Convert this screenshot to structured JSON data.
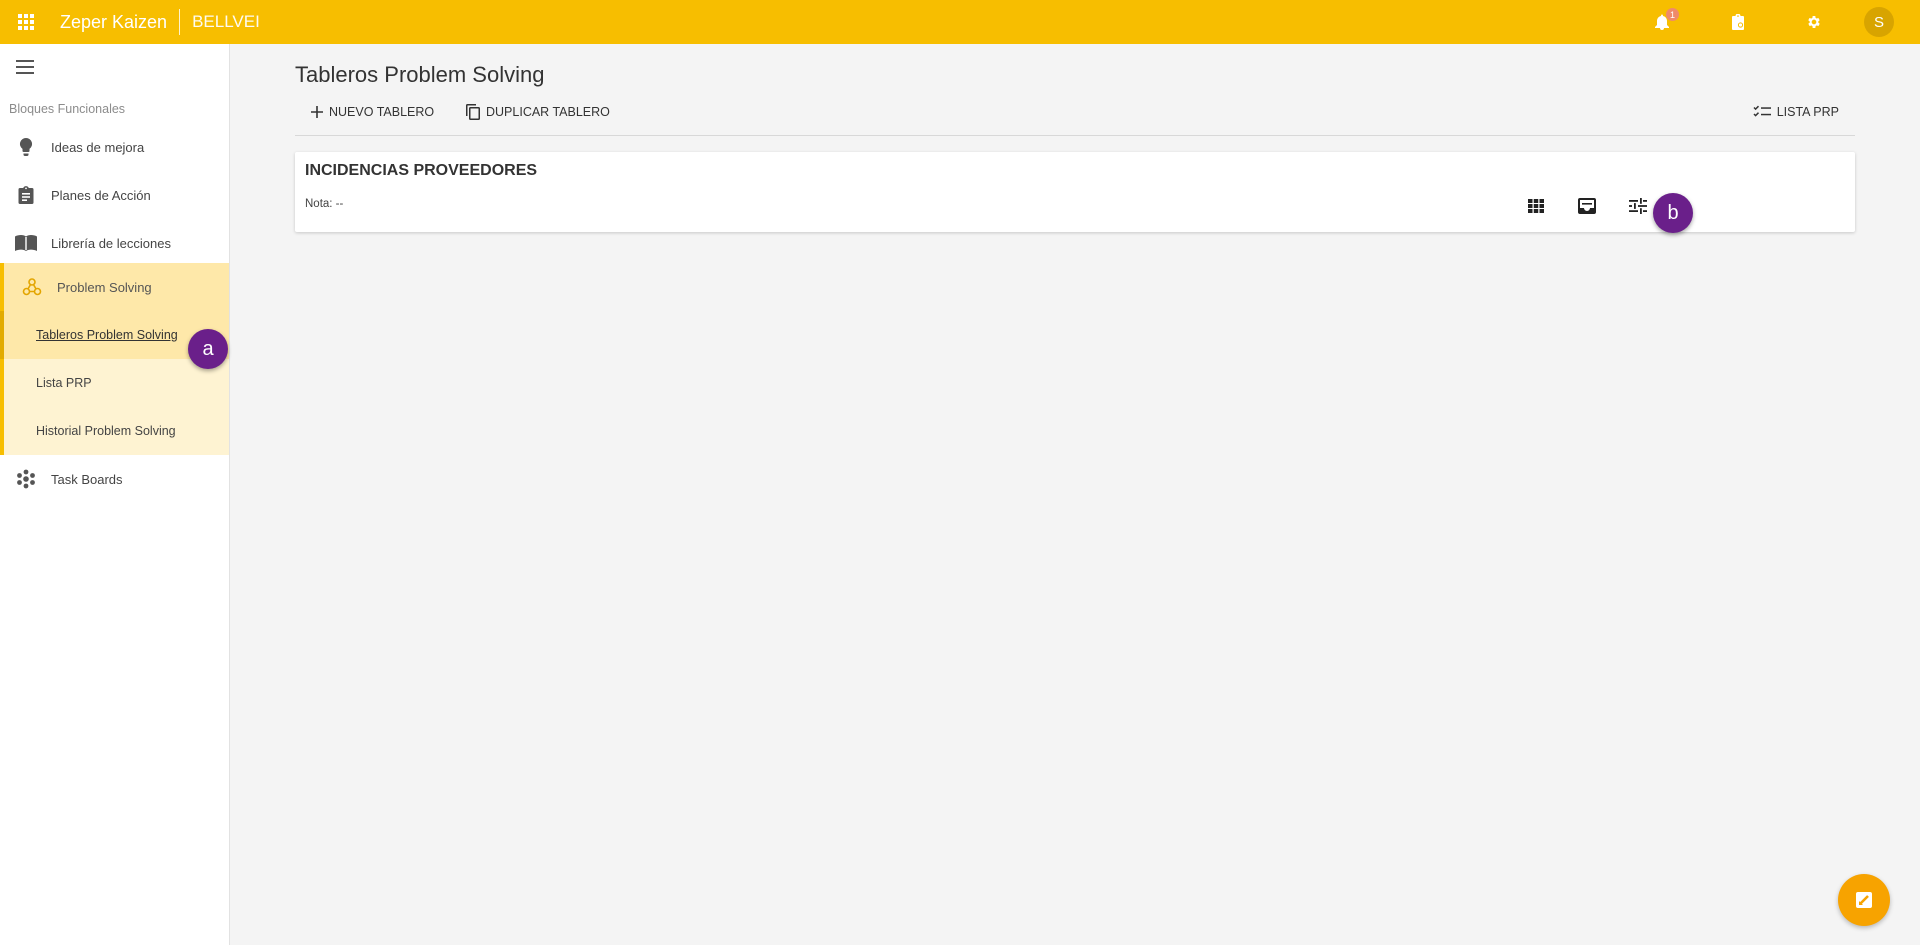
{
  "header": {
    "app_title": "Zeper Kaizen",
    "org_name": "BELLVEI",
    "notification_count": "1",
    "avatar_initial": "S",
    "icons": [
      "apps-icon",
      "bell-icon",
      "clipboard-icon",
      "gear-icon"
    ],
    "bar_color": "#f7be00"
  },
  "sidebar": {
    "section_label": "Bloques Funcionales",
    "items": [
      {
        "label": "Ideas de mejora",
        "icon": "lightbulb-icon"
      },
      {
        "label": "Planes de Acción",
        "icon": "clipboard-list-icon"
      },
      {
        "label": "Librería de lecciones",
        "icon": "book-icon"
      },
      {
        "label": "Problem Solving",
        "icon": "hub-icon"
      },
      {
        "label": "Task Boards",
        "icon": "cluster-icon"
      }
    ],
    "subitems": [
      {
        "label": "Tableros Problem Solving",
        "active": true
      },
      {
        "label": "Lista PRP",
        "active": false
      },
      {
        "label": "Historial Problem Solving",
        "active": false
      }
    ]
  },
  "main": {
    "page_title": "Tableros Problem Solving",
    "toolbar": {
      "new_board": "NUEVO TABLERO",
      "duplicate_board": "DUPLICAR TABLERO",
      "prp_list": "LISTA PRP"
    },
    "board": {
      "title": "INCIDENCIAS PROVEEDORES",
      "note": "Nota: --",
      "actions": [
        "grid-view-icon",
        "inbox-icon",
        "tune-icon"
      ]
    }
  },
  "markers": {
    "a": "a",
    "b": "b"
  }
}
